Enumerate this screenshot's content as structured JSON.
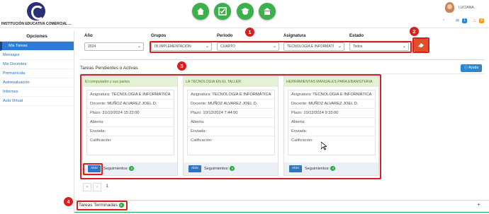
{
  "header": {
    "school_name": "INSTITUCIÓN EDUCATIVA COMERCIAL ...",
    "username": "LUCIANA",
    "badge_messages": "1",
    "badge_alerts": "4",
    "accent": "#3cb04a"
  },
  "sidebar": {
    "title": "Opciones",
    "items": [
      {
        "label": "Mis Tareas"
      },
      {
        "label": "Mensajes"
      },
      {
        "label": "Mis Docentes"
      },
      {
        "label": "Prematrícula"
      },
      {
        "label": "Autoevaluación"
      },
      {
        "label": "Informes"
      },
      {
        "label": "Aula Virtual"
      }
    ]
  },
  "filters": {
    "anio_label": "Año",
    "anio_value": "2024",
    "grupos_label": "Grupos",
    "grupos_value": "05 IMPLEMENTACIÓN",
    "periodo_label": "Periodo",
    "periodo_value": "CUARTO",
    "asignatura_label": "Asignatura",
    "asignatura_value": "TECNOLOGÍA E INFORMÁTI",
    "estado_label": "Estado",
    "estado_value": "Todos"
  },
  "pending": {
    "title": "Tareas Pendientes o Activas",
    "help_label": "Ayuda",
    "labels": {
      "asignatura": "Asignatura:",
      "docente": "Docente:",
      "plazo": "Plazo:",
      "abierta": "Abierta:",
      "enviada": "Enviada:",
      "calificacion": "Calificación:",
      "open_button": "Abrir",
      "seguimientos": "Seguimientos:"
    },
    "cards": [
      {
        "title": "El computador y sus partes",
        "asignatura": "TECNOLOGIA E INFORMÁTICA",
        "docente": "MUÑOZ ALVAREZ JOEL D.",
        "plazo": "31/10/2024 15:22:00",
        "seguimientos": "0"
      },
      {
        "title": "LA TECNOLOGIA EN EL TALLER",
        "asignatura": "TECNOLOGIA E INFORMÁTICA",
        "docente": "MUÑOZ ALVAREZ JOEL D.",
        "plazo": "10/12/2024 7:44:00",
        "seguimientos": "0"
      },
      {
        "title": "HERRAMIENTAS MANUALES PARA EBANISTERIA",
        "asignatura": "TECNOLOGIA E INFORMÁTICA",
        "docente": "MUÑOZ ALVAREZ JOEL D.",
        "plazo": "10/12/2024 9:33:00",
        "seguimientos": "0"
      }
    ]
  },
  "pagination": {
    "prev": "«",
    "next": "‹",
    "current": "1"
  },
  "finished": {
    "title": "Tareas Terminadas",
    "count": "5",
    "expand": "+"
  },
  "callouts": [
    "1",
    "2",
    "3",
    "4"
  ]
}
